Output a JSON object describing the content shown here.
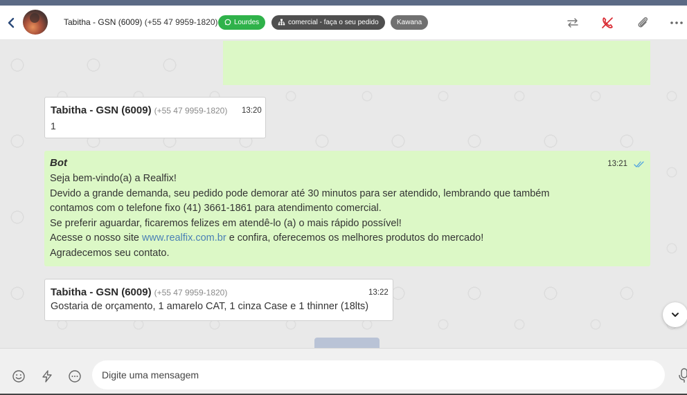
{
  "header": {
    "contact_name": "Tabitha - GSN (6009)",
    "contact_phone": "(+55 47 9959-1820)",
    "tags": [
      {
        "label": "Lourdes",
        "icon": "whatsapp-icon",
        "color": "#2fb24a"
      },
      {
        "label": "comercial - faça o seu pedido",
        "icon": "sitemap-icon",
        "color": "#4f4f4f"
      },
      {
        "label": "Kawana",
        "color": "#707070"
      }
    ],
    "icons": [
      "back-icon",
      "transfer-icon",
      "end-call-icon",
      "attach-icon",
      "more-icon"
    ]
  },
  "messages": [
    {
      "sender": "Tabitha - GSN (6009)",
      "phone": "(+55 47 9959-1820)",
      "time": "13:20",
      "text": "1"
    },
    {
      "sender": "Bot",
      "time": "13:21",
      "status": "read",
      "lines": [
        "Seja bem-vindo(a) a Realfix!",
        "Devido a grande demanda, seu pedido pode demorar até 30 minutos para ser atendido, lembrando que também",
        "contamos com o telefone fixo (41) 3661-1861 para atendimento comercial.",
        "Se preferir aguardar, ficaremos felizes em atendê-lo (a) o mais rápido possível!"
      ],
      "line5_prefix": "Acesse o nosso site ",
      "link": "www.realfix.com.br",
      "line5_suffix": " e confira, oferecemos os melhores produtos do mercado!",
      "line6": "Agradecemos seu contato."
    },
    {
      "sender": "Tabitha - GSN (6009)",
      "phone": "(+55 47 9959-1820)",
      "time": "13:22",
      "text": "Gostaria de orçamento, 1 amarelo CAT, 1 cinza Case e 1 thinner (18lts)"
    }
  ],
  "composer": {
    "placeholder": "Digite uma mensagem",
    "icons": [
      "emoji-icon",
      "quick-reply-icon",
      "chat-bubble-icon",
      "microphone-icon"
    ]
  },
  "colors": {
    "accent_green": "#2fb24a",
    "bubble_green": "#dcf8c6",
    "end_call_red": "#d9262e",
    "link": "#4a7fb5"
  }
}
